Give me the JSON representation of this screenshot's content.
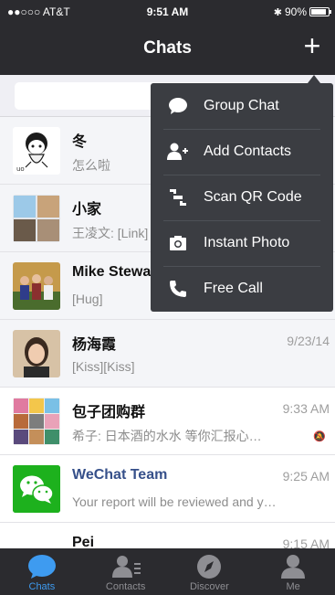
{
  "status_bar": {
    "carrier": "●●○○○ AT&T",
    "time": "9:51 AM",
    "battery": "90%",
    "battery_level": 0.9
  },
  "header": {
    "title": "Chats",
    "add_label": "+"
  },
  "search": {
    "placeholder": "Q"
  },
  "chats": [
    {
      "name": "冬",
      "preview": "怎么啦",
      "time": "",
      "muted": false,
      "name_color": "default"
    },
    {
      "name": "小家",
      "preview": "王凌文: [Link]",
      "time": "",
      "muted": false,
      "name_color": "default"
    },
    {
      "name": "Mike Steward",
      "preview": "[Hug]",
      "time": "",
      "muted": false,
      "name_color": "default"
    },
    {
      "name": "杨海霞",
      "preview": "[Kiss][Kiss]",
      "time": "9/23/14",
      "muted": false,
      "name_color": "default"
    },
    {
      "name": "包子团购群",
      "preview": "希子: 日本酒的水水 等你汇报心…",
      "time": "9:33 AM",
      "muted": true,
      "name_color": "default"
    },
    {
      "name": "WeChat Team",
      "preview": "Your report will be reviewed and y…",
      "time": "9:25 AM",
      "muted": false,
      "name_color": "blue"
    },
    {
      "name": "Pei",
      "preview": "",
      "time": "9:15 AM",
      "muted": false,
      "name_color": "default"
    }
  ],
  "menu": {
    "items": [
      {
        "label": "Group Chat",
        "icon": "speech-bubble-icon"
      },
      {
        "label": "Add Contacts",
        "icon": "add-person-icon"
      },
      {
        "label": "Scan QR Code",
        "icon": "scan-qr-icon"
      },
      {
        "label": "Instant Photo",
        "icon": "camera-icon"
      },
      {
        "label": "Free Call",
        "icon": "phone-icon"
      }
    ]
  },
  "tabbar": {
    "tabs": [
      {
        "label": "Chats",
        "icon": "chat-bubble-icon",
        "active": true
      },
      {
        "label": "Contacts",
        "icon": "contacts-icon",
        "active": false
      },
      {
        "label": "Discover",
        "icon": "compass-icon",
        "active": false
      },
      {
        "label": "Me",
        "icon": "person-icon",
        "active": false
      }
    ]
  },
  "colors": {
    "bar_bg": "#2b2b2f",
    "menu_bg": "#3b3d42",
    "accent_blue": "#3e9bf0",
    "wechat_green": "#1db11d",
    "team_name_blue": "#36508a"
  }
}
